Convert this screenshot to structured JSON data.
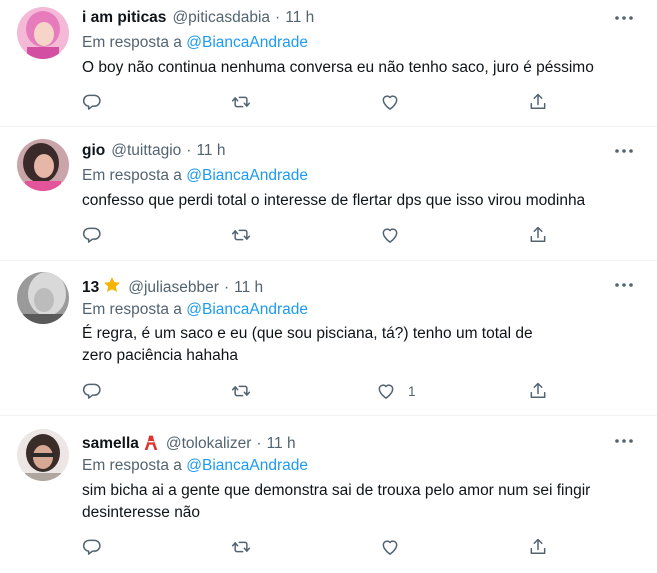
{
  "tweets": [
    {
      "name": "i am piticas",
      "emoji": "",
      "handle": "@piticasdabia",
      "separator": "·",
      "time": "11 h",
      "reply_prefix": "Em resposta a ",
      "reply_to": "@BiancaAndrade",
      "text": "O boy não continua nenhuma conversa eu não tenho saco, juro é péssimo",
      "like_count": ""
    },
    {
      "name": "gio",
      "emoji": "",
      "handle": "@tuittagio",
      "separator": "·",
      "time": "11 h",
      "reply_prefix": "Em resposta a ",
      "reply_to": "@BiancaAndrade",
      "text": "confesso que perdi total o interesse de flertar dps que isso virou modinha",
      "like_count": ""
    },
    {
      "name": "13",
      "emoji": "star",
      "handle": "@juliasebber",
      "separator": "·",
      "time": "11 h",
      "reply_prefix": "Em resposta a ",
      "reply_to": "@BiancaAndrade",
      "text": "É regra, é um saco e eu (que sou pisciana, tá?) tenho um total de zero paciência hahaha",
      "like_count": "1"
    },
    {
      "name": "samella",
      "emoji": "tokyo-tower",
      "handle": "@tolokalizer",
      "separator": "·",
      "time": "11 h",
      "reply_prefix": "Em resposta a ",
      "reply_to": "@BiancaAndrade",
      "text": "sim bicha ai a gente que demonstra sai de trouxa pelo amor num sei fingir desinteresse não",
      "like_count": ""
    }
  ],
  "colors": {
    "text": "#0f1419",
    "secondary": "#536471",
    "link": "#1d9bf0",
    "divider": "#eff3f4",
    "star": "#f4b400",
    "tower": "#e0312b"
  },
  "icons": {
    "more": "ellipsis-icon",
    "reply": "reply-icon",
    "retweet": "retweet-icon",
    "like": "heart-icon",
    "share": "share-icon"
  }
}
